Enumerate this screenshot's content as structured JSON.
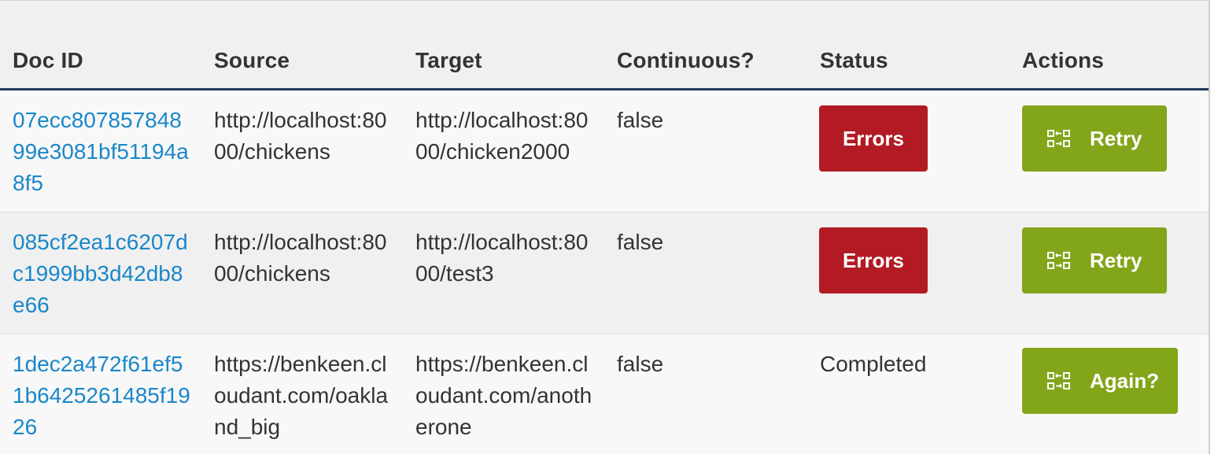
{
  "columns": {
    "doc_id": "Doc ID",
    "source": "Source",
    "target": "Target",
    "continuous": "Continuous?",
    "status": "Status",
    "actions": "Actions"
  },
  "rows": [
    {
      "doc_id": "07ecc80785784899e3081bf51194a8f5",
      "source": "http://localhost:8000/chickens",
      "target": "http://localhost:8000/chicken2000",
      "continuous": "false",
      "status_button": "Errors",
      "action_label": "Retry",
      "action_icon": "replication-icon"
    },
    {
      "doc_id": "085cf2ea1c6207dc1999bb3d42db8e66",
      "source": "http://localhost:8000/chickens",
      "target": "http://localhost:8000/test3",
      "continuous": "false",
      "status_button": "Errors",
      "action_label": "Retry",
      "action_icon": "replication-icon"
    },
    {
      "doc_id": "1dec2a472f61ef51b6425261485f1926",
      "source": "https://benkeen.cloudant.com/oakland_big",
      "target": "https://benkeen.cloudant.com/anotherone",
      "continuous": "false",
      "status_text": "Completed",
      "action_label": "Again?",
      "action_icon": "replication-icon"
    }
  ],
  "colors": {
    "link": "#1a87c9",
    "error_button": "#b21b24",
    "action_button": "#83a51a",
    "header_rule": "#24395a"
  }
}
